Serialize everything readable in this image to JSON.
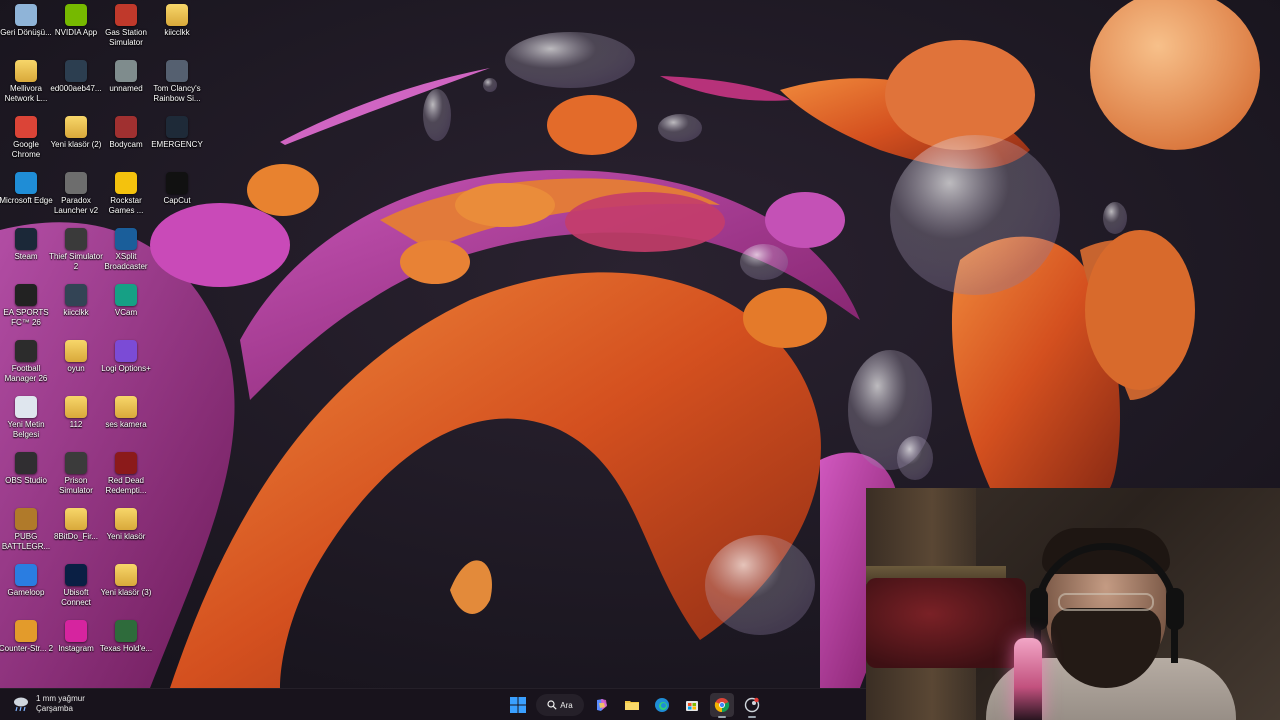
{
  "desktop_icons": [
    {
      "label": "Geri Dönüşü...",
      "icon": "recycle-bin-icon",
      "color": "#8fb4d8"
    },
    {
      "label": "NVIDIA App",
      "icon": "nvidia-icon",
      "color": "#76b900"
    },
    {
      "label": "Gas Station Simulator",
      "icon": "gas-station-icon",
      "color": "#c0392b"
    },
    {
      "label": "kiicclkk",
      "icon": "folder-icon",
      "color": "#e2b84a"
    },
    {
      "label": "Mellivora Network L...",
      "icon": "folder-icon",
      "color": "#e2b84a"
    },
    {
      "label": "ed000aeb47...",
      "icon": "image-file-icon",
      "color": "#2c3e50"
    },
    {
      "label": "unnamed",
      "icon": "image-file-icon",
      "color": "#7f8c8d"
    },
    {
      "label": "Tom Clancy's Rainbow Si...",
      "icon": "rainbow-six-icon",
      "color": "#556070"
    },
    {
      "label": "Google Chrome",
      "icon": "chrome-icon",
      "color": "#db4437"
    },
    {
      "label": "Yeni klasör (2)",
      "icon": "folder-icon",
      "color": "#e2b84a"
    },
    {
      "label": "Bodycam",
      "icon": "bodycam-icon",
      "color": "#a03030"
    },
    {
      "label": "EMERGENCY",
      "icon": "emergency-icon",
      "color": "#1e2a38"
    },
    {
      "label": "Microsoft Edge",
      "icon": "edge-icon",
      "color": "#1f8dd6"
    },
    {
      "label": "Paradox Launcher v2",
      "icon": "paradox-icon",
      "color": "#6d6d6d"
    },
    {
      "label": "Rockstar Games ...",
      "icon": "rockstar-icon",
      "color": "#f4c20d"
    },
    {
      "label": "CapCut",
      "icon": "capcut-icon",
      "color": "#111111"
    },
    {
      "label": "Steam",
      "icon": "steam-icon",
      "color": "#1b2838"
    },
    {
      "label": "Thief Simulator 2",
      "icon": "thief-sim-icon",
      "color": "#3a3a3a"
    },
    {
      "label": "XSplit Broadcaster",
      "icon": "xsplit-icon",
      "color": "#1a5e9a"
    },
    {
      "label": "",
      "icon": "blank",
      "color": "transparent"
    },
    {
      "label": "EA SPORTS FC™ 26",
      "icon": "ea-fc-icon",
      "color": "#222222"
    },
    {
      "label": "kiicclkk",
      "icon": "image-file-icon",
      "color": "#334455"
    },
    {
      "label": "VCam",
      "icon": "vcam-icon",
      "color": "#16a085"
    },
    {
      "label": "",
      "icon": "blank",
      "color": "transparent"
    },
    {
      "label": "Football Manager 26",
      "icon": "football-manager-icon",
      "color": "#2c2c2c"
    },
    {
      "label": "oyun",
      "icon": "folder-icon",
      "color": "#e2b84a"
    },
    {
      "label": "Logi Options+",
      "icon": "logi-icon",
      "color": "#7b4bd6"
    },
    {
      "label": "",
      "icon": "blank",
      "color": "transparent"
    },
    {
      "label": "Yeni Metin Belgesi",
      "icon": "text-file-icon",
      "color": "#dfe6ee"
    },
    {
      "label": "112",
      "icon": "folder-icon",
      "color": "#e2b84a"
    },
    {
      "label": "ses kamera",
      "icon": "folder-icon",
      "color": "#e2b84a"
    },
    {
      "label": "",
      "icon": "blank",
      "color": "transparent"
    },
    {
      "label": "OBS Studio",
      "icon": "obs-icon",
      "color": "#302e31"
    },
    {
      "label": "Prison Simulator",
      "icon": "prison-sim-icon",
      "color": "#3b3b3b"
    },
    {
      "label": "Red Dead Redempti...",
      "icon": "red-dead-icon",
      "color": "#8b1a1a"
    },
    {
      "label": "",
      "icon": "blank",
      "color": "transparent"
    },
    {
      "label": "PUBG BATTLEGR...",
      "icon": "pubg-icon",
      "color": "#b07a2a"
    },
    {
      "label": "8BitDo_Fir...",
      "icon": "folder-icon",
      "color": "#e2b84a"
    },
    {
      "label": "Yeni klasör",
      "icon": "folder-icon",
      "color": "#e2b84a"
    },
    {
      "label": "",
      "icon": "blank",
      "color": "transparent"
    },
    {
      "label": "Gameloop",
      "icon": "gameloop-icon",
      "color": "#2a7de1"
    },
    {
      "label": "Ubisoft Connect",
      "icon": "ubisoft-icon",
      "color": "#0a1f44"
    },
    {
      "label": "Yeni klasör (3)",
      "icon": "folder-icon",
      "color": "#e2b84a"
    },
    {
      "label": "",
      "icon": "blank",
      "color": "transparent"
    },
    {
      "label": "Counter-Str... 2",
      "icon": "cs2-icon",
      "color": "#e39b2b"
    },
    {
      "label": "Instagram",
      "icon": "instagram-icon",
      "color": "#d6249f"
    },
    {
      "label": "Texas Hold'e...",
      "icon": "poker-icon",
      "color": "#2e6b3b"
    }
  ],
  "taskbar": {
    "weather_line1": "1 mm yağmur",
    "weather_line2": "Çarşamba",
    "search_label": "Ara",
    "apps": [
      {
        "name": "start-button",
        "icon": "windows-icon"
      },
      {
        "name": "copilot",
        "icon": "copilot-icon"
      },
      {
        "name": "file-explorer",
        "icon": "folder-icon"
      },
      {
        "name": "edge",
        "icon": "edge-icon"
      },
      {
        "name": "store",
        "icon": "store-icon"
      },
      {
        "name": "chrome",
        "icon": "chrome-icon"
      },
      {
        "name": "notification-app",
        "icon": "steam-like-icon"
      }
    ]
  },
  "colors": {
    "taskbar_bg": "#18141c",
    "accent_start": "#3aa0ff"
  }
}
